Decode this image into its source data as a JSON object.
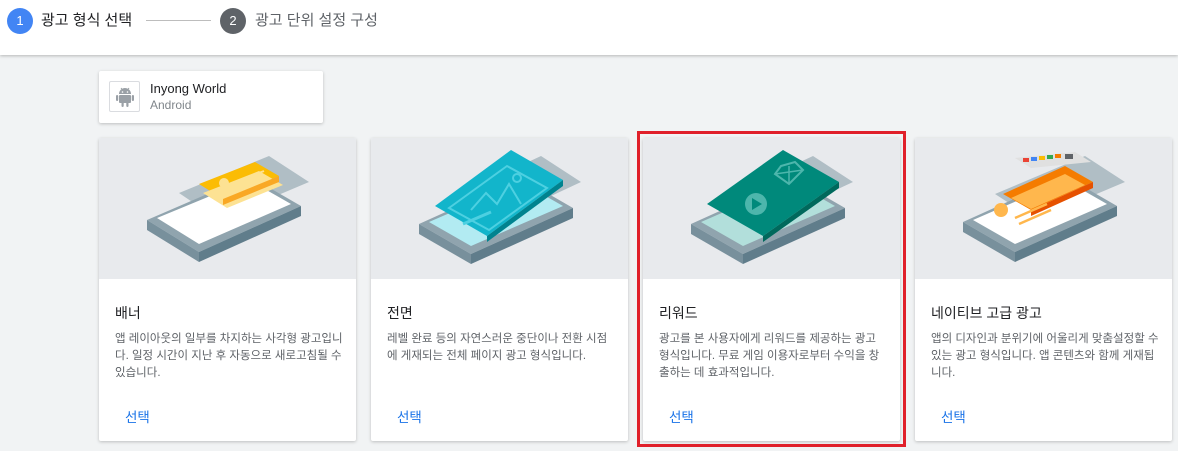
{
  "stepper": {
    "steps": [
      {
        "number": "1",
        "label": "광고 형식 선택",
        "state": "active"
      },
      {
        "number": "2",
        "label": "광고 단위 설정 구성",
        "state": "inactive"
      }
    ],
    "colors": {
      "active": "#4285f4",
      "inactive": "#5f6368"
    }
  },
  "app": {
    "name": "Inyong World",
    "platform": "Android",
    "icon": "android-icon"
  },
  "cards": [
    {
      "title": "배너",
      "description": "앱 레이아웃의 일부를 차지하는 사각형 광고입니다. 일정 시간이 지난 후 자동으로 새로고침될 수 있습니다.",
      "action": "선택",
      "illustration": "banner-illustration",
      "accent": "#fbbc04"
    },
    {
      "title": "전면",
      "description": "레벨 완료 등의 자연스러운 중단이나 전환 시점에 게재되는 전체 페이지 광고 형식입니다.",
      "action": "선택",
      "illustration": "interstitial-illustration",
      "accent": "#12b5cb"
    },
    {
      "title": "리워드",
      "description": "광고를 본 사용자에게 리워드를 제공하는 광고 형식입니다. 무료 게임 이용자로부터 수익을 창출하는 데 효과적입니다.",
      "action": "선택",
      "illustration": "rewarded-illustration",
      "accent": "#00897b",
      "highlighted": true
    },
    {
      "title": "네이티브 고급 광고",
      "description": "앱의 디자인과 분위기에 어울리게 맞춤설정할 수 있는 광고 형식입니다. 앱 콘텐츠와 함께 게재됩니다.",
      "action": "선택",
      "illustration": "native-advanced-illustration",
      "accent": "#f57c00"
    }
  ],
  "highlight_color": "#e0202a"
}
